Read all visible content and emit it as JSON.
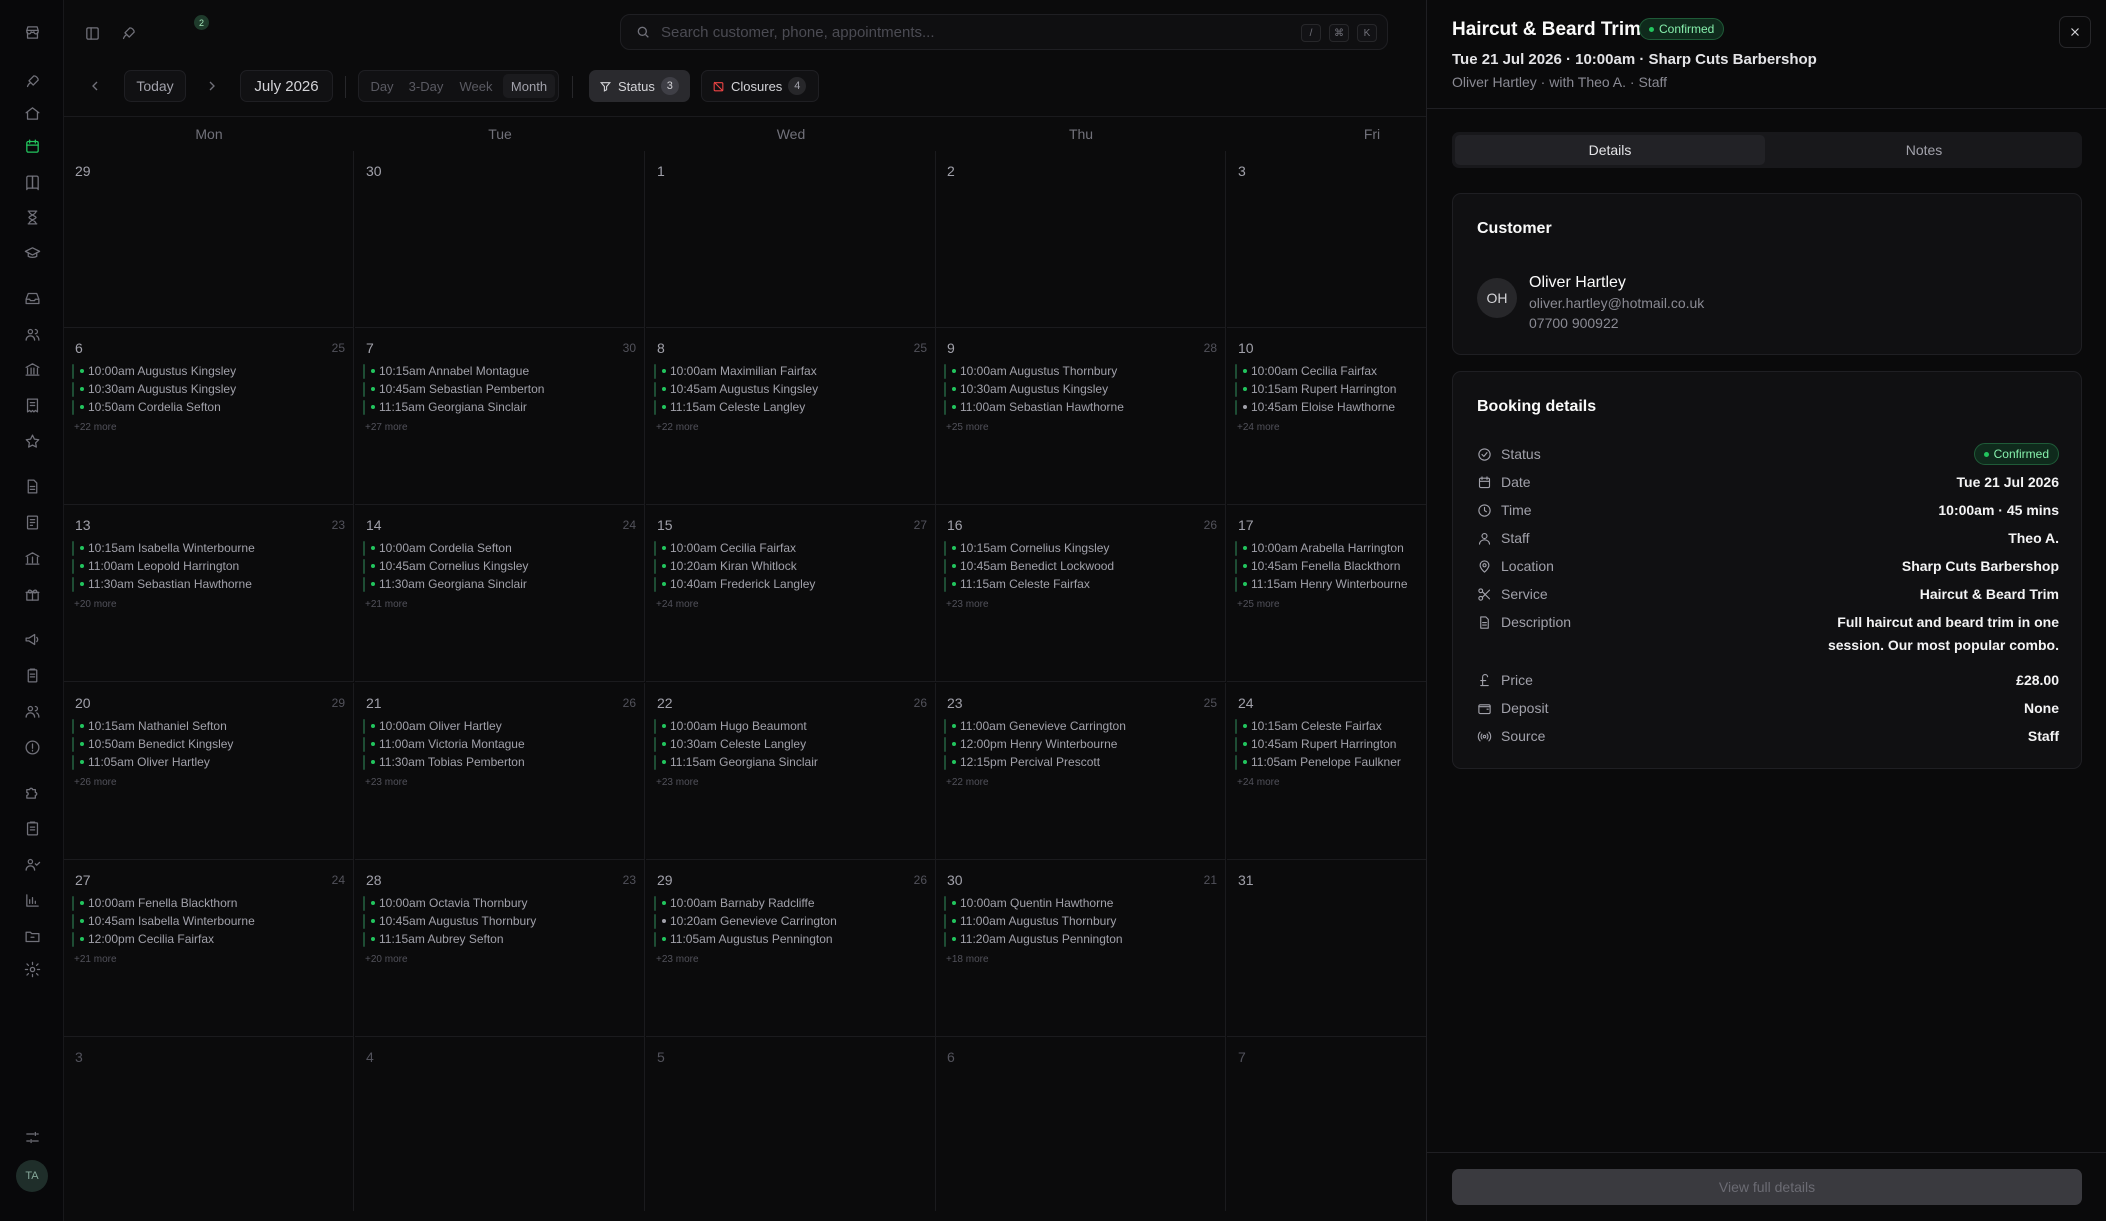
{
  "app": {
    "user_initials": "TA",
    "notification_count": "2"
  },
  "search": {
    "placeholder": "Search customer, phone, appointments...",
    "value": "",
    "shortcut_keys": [
      "/",
      "⌘",
      "K"
    ]
  },
  "toolbar": {
    "today_label": "Today",
    "month_label": "July 2026",
    "views": [
      {
        "label": "Day"
      },
      {
        "label": "3-Day"
      },
      {
        "label": "Week"
      },
      {
        "label": "Month"
      }
    ],
    "active_view": "Month",
    "status_label": "Status",
    "status_count": "3",
    "closures_label": "Closures",
    "closures_count": "4"
  },
  "calendar": {
    "weekdays": [
      "Mon",
      "Tue",
      "Wed",
      "Thu",
      "Fri"
    ],
    "weeks": [
      [
        {
          "day": "29",
          "count": "",
          "muted": false,
          "appts": [],
          "more": ""
        },
        {
          "day": "30",
          "count": "",
          "muted": false,
          "appts": [],
          "more": ""
        },
        {
          "day": "1",
          "count": "",
          "muted": false,
          "appts": [],
          "more": ""
        },
        {
          "day": "2",
          "count": "",
          "muted": false,
          "appts": [],
          "more": ""
        },
        {
          "day": "3",
          "count": "",
          "muted": false,
          "appts": [],
          "more": ""
        }
      ],
      [
        {
          "day": "6",
          "count": "25",
          "appts": [
            "10:00am Augustus Kingsley",
            "10:30am Augustus Kingsley",
            "10:50am Cordelia Sefton"
          ],
          "more": "+22 more"
        },
        {
          "day": "7",
          "count": "30",
          "appts": [
            "10:15am Annabel Montague",
            "10:45am Sebastian Pemberton",
            "11:15am Georgiana Sinclair"
          ],
          "more": "+27 more"
        },
        {
          "day": "8",
          "count": "25",
          "appts": [
            "10:00am Maximilian Fairfax",
            "10:45am Augustus Kingsley",
            "11:15am Celeste Langley"
          ],
          "more": "+22 more"
        },
        {
          "day": "9",
          "count": "28",
          "appts": [
            "10:00am Augustus Thornbury",
            "10:30am Augustus Kingsley",
            "11:00am Sebastian Hawthorne"
          ],
          "more": "+25 more"
        },
        {
          "day": "10",
          "count": "",
          "appts": [
            "10:00am Cecilia Fairfax",
            "10:15am Rupert Harrington",
            "10:45am Eloise Hawthorne"
          ],
          "more": "+24 more"
        }
      ],
      [
        {
          "day": "13",
          "count": "23",
          "appts": [
            "10:15am Isabella Winterbourne",
            "11:00am Leopold Harrington",
            "11:30am Sebastian Hawthorne"
          ],
          "more": "+20 more"
        },
        {
          "day": "14",
          "count": "24",
          "appts": [
            "10:00am Cordelia Sefton",
            "10:45am Cornelius Kingsley",
            "11:30am Georgiana Sinclair"
          ],
          "more": "+21 more"
        },
        {
          "day": "15",
          "count": "27",
          "appts": [
            "10:00am Cecilia Fairfax",
            "10:20am Kiran Whitlock",
            "10:40am Frederick Langley"
          ],
          "more": "+24 more"
        },
        {
          "day": "16",
          "count": "26",
          "appts": [
            "10:15am Cornelius Kingsley",
            "10:45am Benedict Lockwood",
            "11:15am Celeste Fairfax"
          ],
          "more": "+23 more"
        },
        {
          "day": "17",
          "count": "",
          "appts": [
            "10:00am Arabella Harrington",
            "10:45am Fenella Blackthorn",
            "11:15am Henry Winterbourne"
          ],
          "more": "+25 more"
        }
      ],
      [
        {
          "day": "20",
          "count": "29",
          "appts": [
            "10:15am Nathaniel Sefton",
            "10:50am Benedict Kingsley",
            "11:05am Oliver Hartley"
          ],
          "more": "+26 more"
        },
        {
          "day": "21",
          "count": "26",
          "appts": [
            "10:00am Oliver Hartley",
            "11:00am Victoria Montague",
            "11:30am Tobias Pemberton"
          ],
          "more": "+23 more"
        },
        {
          "day": "22",
          "count": "26",
          "appts": [
            "10:00am Hugo Beaumont",
            "10:30am Celeste Langley",
            "11:15am Georgiana Sinclair"
          ],
          "more": "+23 more"
        },
        {
          "day": "23",
          "count": "25",
          "appts": [
            "11:00am Genevieve Carrington",
            "12:00pm Henry Winterbourne",
            "12:15pm Percival Prescott"
          ],
          "more": "+22 more"
        },
        {
          "day": "24",
          "count": "",
          "appts": [
            "10:15am Celeste Fairfax",
            "10:45am Rupert Harrington",
            "11:05am Penelope Faulkner"
          ],
          "more": "+24 more"
        }
      ],
      [
        {
          "day": "27",
          "count": "24",
          "appts": [
            "10:00am Fenella Blackthorn",
            "10:45am Isabella Winterbourne",
            "12:00pm Cecilia Fairfax"
          ],
          "more": "+21 more"
        },
        {
          "day": "28",
          "count": "23",
          "appts": [
            "10:00am Octavia Thornbury",
            "10:45am Augustus Thornbury",
            "11:15am Aubrey Sefton"
          ],
          "more": "+20 more"
        },
        {
          "day": "29",
          "count": "26",
          "appts": [
            "10:00am Barnaby Radcliffe",
            "10:20am Genevieve Carrington",
            "11:05am Augustus Pennington"
          ],
          "more": "+23 more"
        },
        {
          "day": "30",
          "count": "21",
          "appts": [
            "10:00am Quentin Hawthorne",
            "11:00am Augustus Thornbury",
            "11:20am Augustus Pennington"
          ],
          "more": "+18 more"
        },
        {
          "day": "31",
          "count": "",
          "appts": [],
          "more": ""
        }
      ],
      [
        {
          "day": "3",
          "count": "",
          "muted": true,
          "appts": [],
          "more": ""
        },
        {
          "day": "4",
          "count": "",
          "muted": true,
          "appts": [],
          "more": ""
        },
        {
          "day": "5",
          "count": "",
          "muted": true,
          "appts": [],
          "more": ""
        },
        {
          "day": "6",
          "count": "",
          "muted": true,
          "appts": [],
          "more": ""
        },
        {
          "day": "7",
          "count": "",
          "muted": true,
          "appts": [],
          "more": ""
        }
      ]
    ]
  },
  "panel": {
    "title": "Haircut & Beard Trim",
    "status_badge": "Confirmed",
    "subtitle": "Tue 21 Jul 2026 · 10:00am · Sharp Cuts Barbershop",
    "meta": "Oliver Hartley · with Theo A. · Staff",
    "tabs": [
      {
        "label": "Details"
      },
      {
        "label": "Notes"
      }
    ],
    "active_tab": "Details",
    "customer": {
      "heading": "Customer",
      "initials": "OH",
      "name": "Oliver Hartley",
      "email": "oliver.hartley@hotmail.co.uk",
      "phone": "07700 900922"
    },
    "booking": {
      "heading": "Booking details",
      "rows": [
        {
          "label": "Status",
          "value": "Confirmed",
          "icon": "check-circle-icon"
        },
        {
          "label": "Date",
          "value": "Tue 21 Jul 2026",
          "icon": "calendar-icon"
        },
        {
          "label": "Time",
          "value": "10:00am · 45 mins",
          "icon": "clock-icon"
        },
        {
          "label": "Staff",
          "value": "Theo A.",
          "icon": "user-icon"
        },
        {
          "label": "Location",
          "value": "Sharp Cuts Barbershop",
          "icon": "map-pin-icon"
        },
        {
          "label": "Service",
          "value": "Haircut & Beard Trim",
          "icon": "scissors-icon"
        },
        {
          "label": "Description",
          "value": "Full haircut and beard trim in one session. Our most popular combo.",
          "icon": "file-text-icon"
        },
        {
          "label": "Price",
          "value": "£28.00",
          "icon": "pound-icon"
        },
        {
          "label": "Deposit",
          "value": "None",
          "icon": "wallet-icon"
        },
        {
          "label": "Source",
          "value": "Staff",
          "icon": "broadcast-icon"
        }
      ]
    },
    "footer_button": "View full details"
  }
}
